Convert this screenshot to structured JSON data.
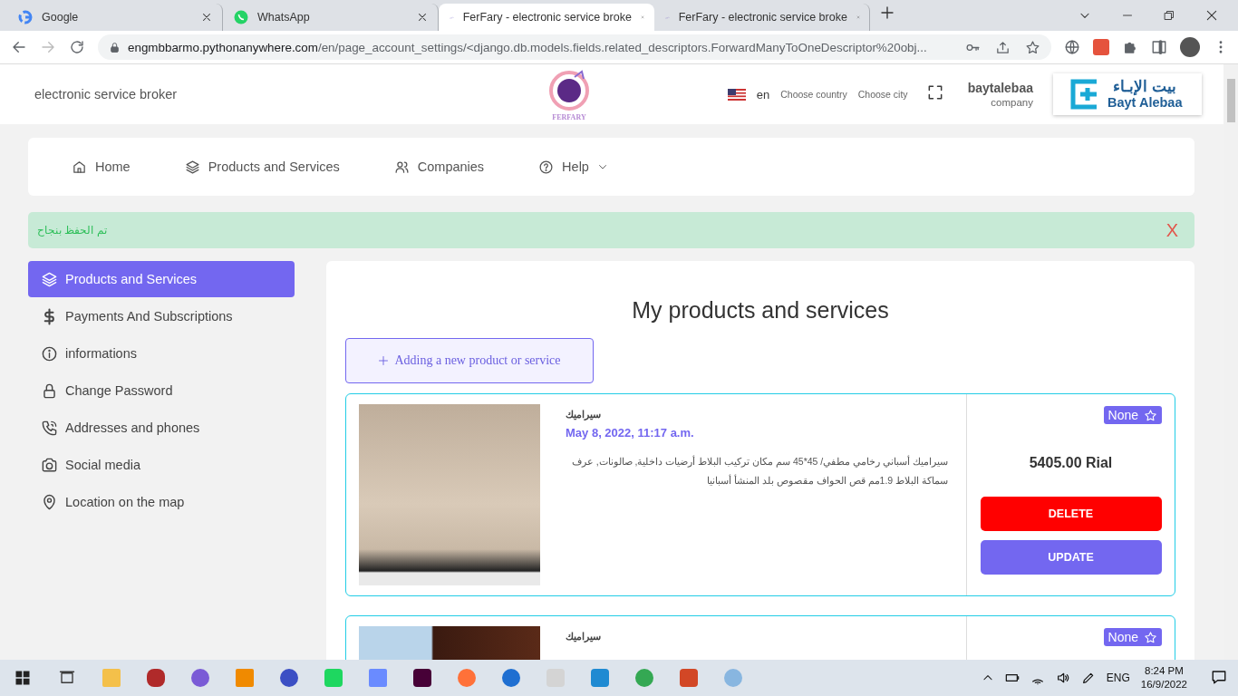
{
  "browser": {
    "tabs": [
      {
        "title": "Google",
        "selected": false
      },
      {
        "title": "WhatsApp",
        "selected": false
      },
      {
        "title": "FerFary - electronic service broke",
        "selected": true
      },
      {
        "title": "FerFary - electronic service broke",
        "selected": false
      }
    ],
    "url_host": "engmbbarmo.pythonanywhere.com",
    "url_path": "/en/page_account_settings/<django.db.models.fields.related_descriptors.ForwardManyToOneDescriptor%20obj..."
  },
  "header": {
    "tagline": "electronic service broker",
    "logo_text": "FERFARY",
    "language": "en",
    "country_link": "Choose country",
    "city_link": "Choose city",
    "account_name": "baytalebaa",
    "account_type": "company",
    "brand_arabic": "بيت الإبـاء",
    "brand_latin": "Bayt Alebaa"
  },
  "nav": [
    {
      "label": "Home"
    },
    {
      "label": "Products and Services"
    },
    {
      "label": "Companies"
    },
    {
      "label": "Help"
    }
  ],
  "alert": {
    "message": "تم الحفظ بنجاح",
    "close": "X"
  },
  "sidebar": {
    "items": [
      {
        "label": "Products and Services",
        "selected": true
      },
      {
        "label": "Payments And Subscriptions",
        "selected": false
      },
      {
        "label": "informations",
        "selected": false
      },
      {
        "label": "Change Password",
        "selected": false
      },
      {
        "label": "Addresses and phones",
        "selected": false
      },
      {
        "label": "Social media",
        "selected": false
      },
      {
        "label": "Location on the map",
        "selected": false
      }
    ]
  },
  "content": {
    "title": "My products and services",
    "add_button": "Adding a new product or service",
    "products": [
      {
        "title": "سيراميك",
        "date": "May 8, 2022, 11:17 a.m.",
        "description": "سيراميك أسباني رخامي مطفي/ 45*45 سم مكان تركيب البلاط أرضيات داخلية, صالونات, عرف سماكة البلاط 1.9مم قص الحواف مقصوص بلد المنشأ أسبانيا",
        "price": "5405.00 Rial",
        "badge": "None",
        "actions": [
          {
            "label": "DELETE",
            "kind": "danger"
          },
          {
            "label": "UPDATE",
            "kind": "primary"
          }
        ]
      },
      {
        "title": "سيراميك",
        "badge": "None"
      }
    ]
  },
  "taskbar": {
    "language": "ENG",
    "time": "8:24 PM",
    "date": "16/9/2022"
  }
}
